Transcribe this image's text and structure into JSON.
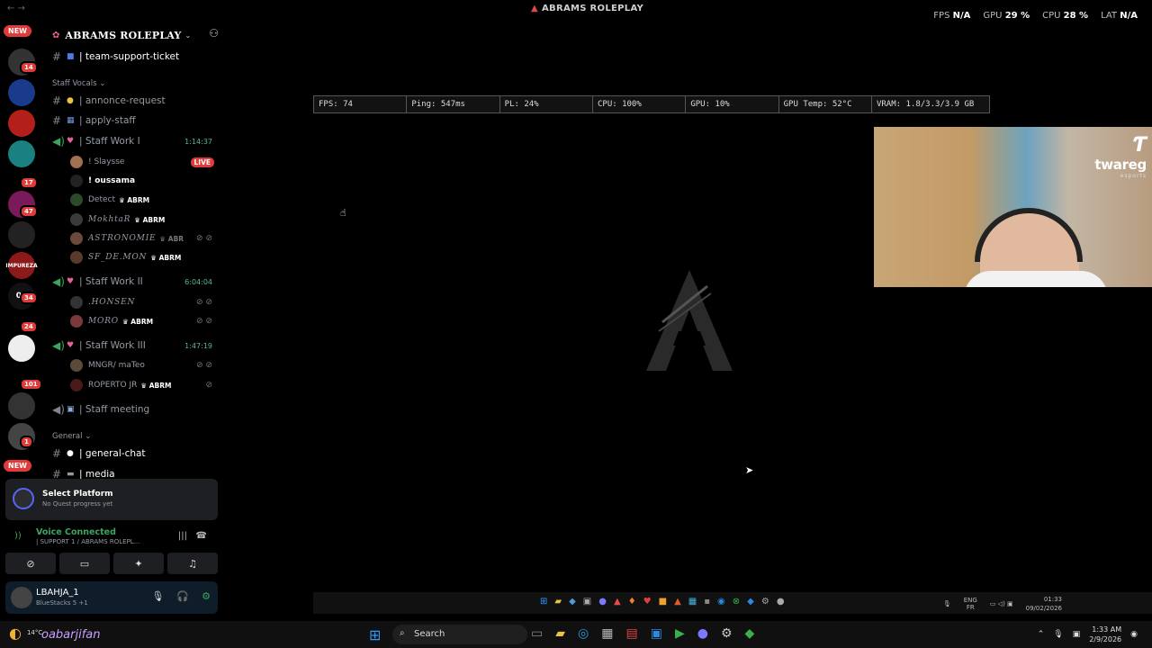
{
  "window": {
    "title": "ABRAMS ROLEPLAY",
    "stats": [
      {
        "label": "FPS",
        "value": "N/A"
      },
      {
        "label": "GPU",
        "value": "29 %"
      },
      {
        "label": "CPU",
        "value": "28 %"
      },
      {
        "label": "LAT",
        "value": "N/A"
      }
    ]
  },
  "server": {
    "name": "ABRAMS ROLEPLAY"
  },
  "rail": {
    "new_badge_top": "NEW",
    "new_badge_bottom": "NEW",
    "counts": [
      "14",
      "17",
      "47",
      "34",
      "24",
      "101",
      "1"
    ]
  },
  "channels": {
    "team_support": "| team-support-ticket",
    "category_staff_vocals": "Staff Vocals",
    "annonce_request": "| annonce-request",
    "apply_staff": "| apply-staff",
    "staff_work_1": "| Staff Work I",
    "staff_work_1_time": "1:14:37",
    "staff_work_2": "| Staff Work II",
    "staff_work_2_time": "6:04:04",
    "staff_work_3": "| Staff Work III",
    "staff_work_3_time": "1:47:19",
    "staff_meeting": "| Staff meeting",
    "category_general": "General",
    "general_chat": "| general-chat",
    "media": "| media"
  },
  "users": {
    "u1": "! Slaysse",
    "u1_live": "LIVE",
    "u2": "! oussama",
    "u3": "Detect",
    "u4": "MokhtaR",
    "u5": "ASTRONOMIE",
    "u6": "SF_DE.MON",
    "u7": ".HONSEN",
    "u8": "MORO",
    "u9": "MNGR/ maTeo",
    "u10": "ROPERTO JR",
    "tag": "ABRM",
    "tag_clip": "ABR"
  },
  "quest": {
    "title": "Select Platform",
    "subtitle": "No Quest progress yet"
  },
  "voice": {
    "status": "Voice Connected",
    "channel": "| SUPPORT 1 / ABRAMS ROLEPL..."
  },
  "user_panel": {
    "name": "LBAHJA_1",
    "status": "BlueStacks 5 +1"
  },
  "overlay": {
    "cells": [
      "FPS: 74",
      "Ping: 547ms",
      "PL: 24%",
      "CPU: 100%",
      "GPU: 10%",
      "GPU Temp: 52°C",
      "VRAM: 1.8/3.3/3.9 GB"
    ]
  },
  "webcam": {
    "brand": "twareg",
    "brand_sub": "esports"
  },
  "inner_taskbar": {
    "lang": "ENG",
    "lang2": "FR",
    "time": "01:33",
    "date": "09/02/2026"
  },
  "taskbar": {
    "temp": "14°C",
    "watermark": "oabarjifan",
    "search": "Search",
    "time": "1:33 AM",
    "date": "2/9/2026"
  }
}
